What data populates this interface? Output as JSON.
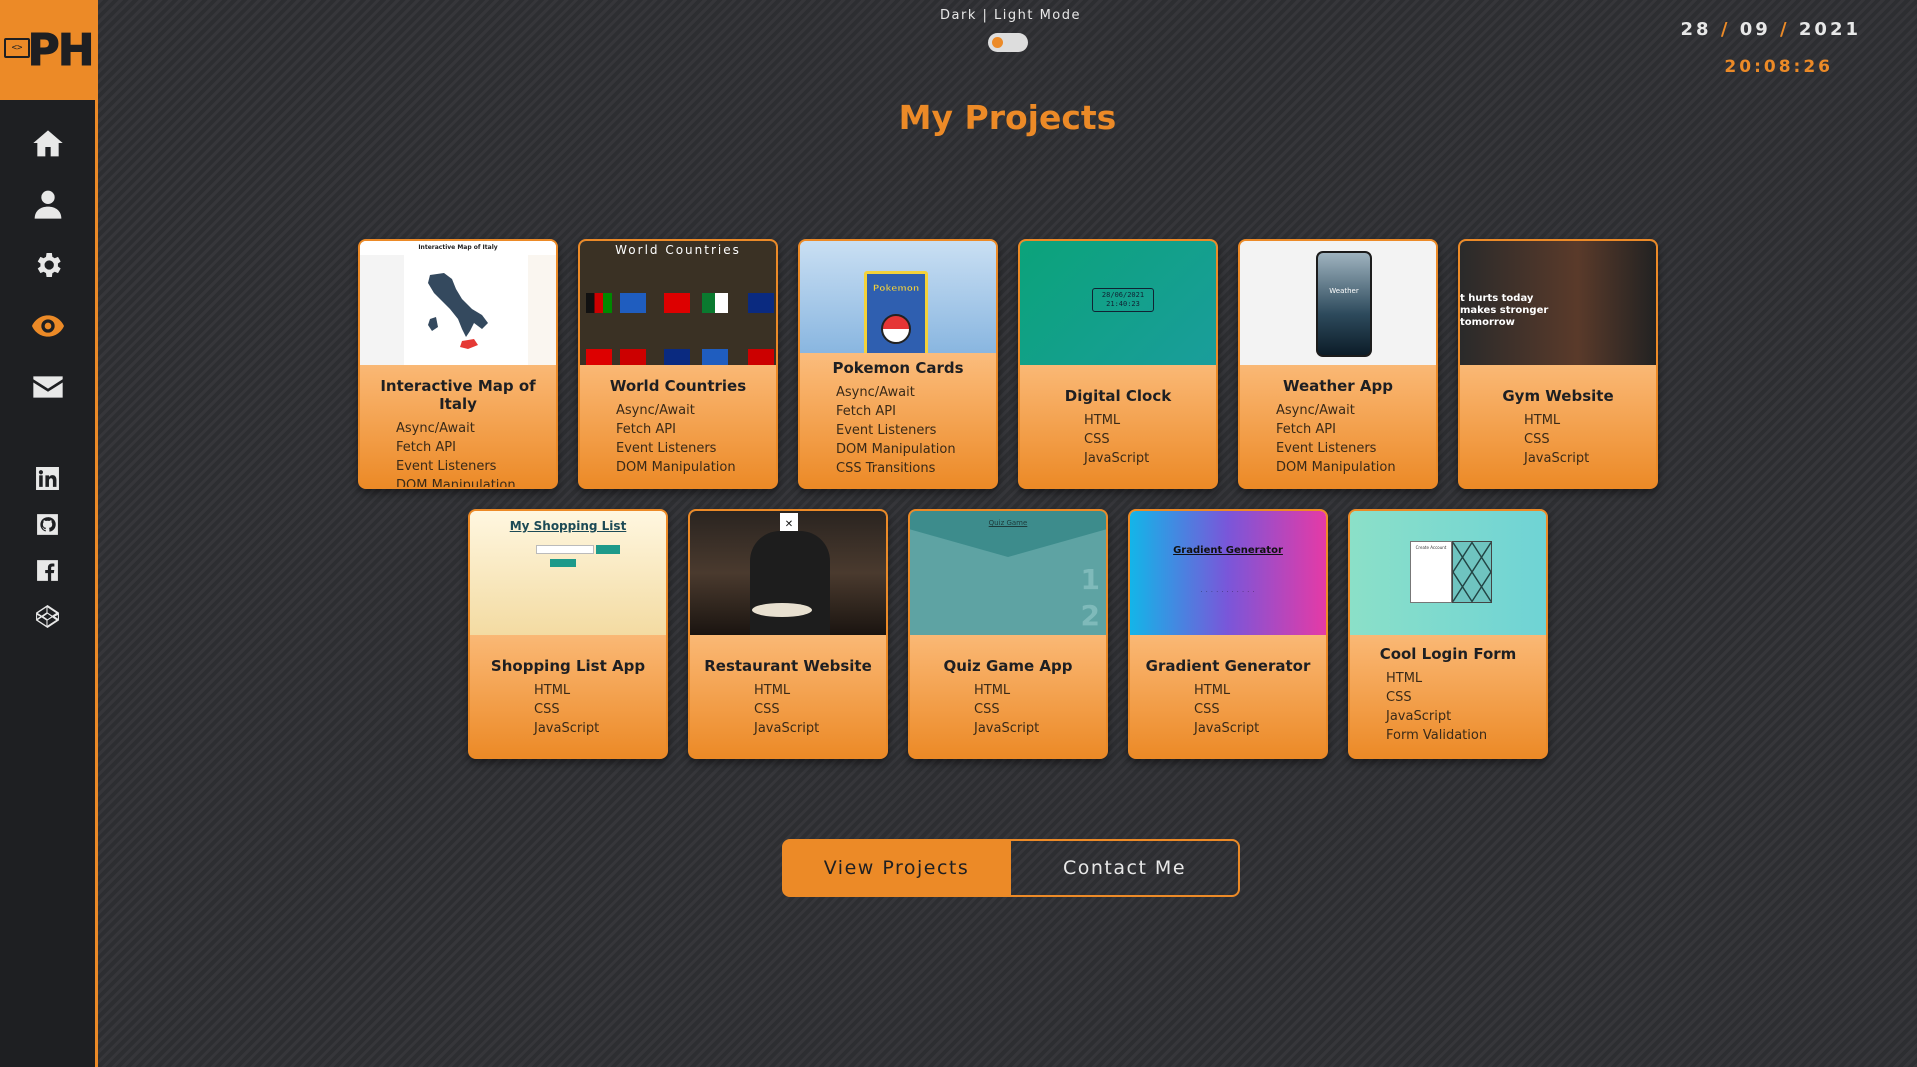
{
  "logo": {
    "text": "PH",
    "code_symbol": "<>"
  },
  "nav": {
    "items": [
      {
        "icon": "home-icon",
        "active": false
      },
      {
        "icon": "user-icon",
        "active": false
      },
      {
        "icon": "gear-icon",
        "active": false
      },
      {
        "icon": "eye-icon",
        "active": true
      },
      {
        "icon": "envelope-icon",
        "active": false
      }
    ],
    "social": [
      "linkedin-icon",
      "github-icon",
      "facebook-icon",
      "codepen-icon"
    ]
  },
  "mode": {
    "label": "Dark | Light Mode"
  },
  "clock": {
    "day": "28",
    "month": "09",
    "year": "2021",
    "sep": "/",
    "time": "20:08:26"
  },
  "page": {
    "title": "My Projects"
  },
  "projects": [
    {
      "title": "Interactive Map of Italy",
      "tags": [
        "Async/Await",
        "Fetch API",
        "Event Listeners",
        "DOM Manipulation"
      ],
      "thumb_text": "Interactive Map of Italy"
    },
    {
      "title": "World Countries",
      "tags": [
        "Async/Await",
        "Fetch API",
        "Event Listeners",
        "DOM Manipulation"
      ],
      "thumb_text": "World Countries"
    },
    {
      "title": "Pokemon Cards",
      "tags": [
        "Async/Await",
        "Fetch API",
        "Event Listeners",
        "DOM Manipulation",
        "CSS Transitions"
      ],
      "thumb_text": "Pokemon"
    },
    {
      "title": "Digital Clock",
      "tags": [
        "HTML",
        "CSS",
        "JavaScript"
      ],
      "thumb_text": "28/06/2021 21:40:23"
    },
    {
      "title": "Weather App",
      "tags": [
        "Async/Await",
        "Fetch API",
        "Event Listeners",
        "DOM Manipulation"
      ],
      "thumb_text": "Weather"
    },
    {
      "title": "Gym Website",
      "tags": [
        "HTML",
        "CSS",
        "JavaScript"
      ],
      "thumb_text": "t hurts today makes stronger tomorrow"
    },
    {
      "title": "Shopping List App",
      "tags": [
        "HTML",
        "CSS",
        "JavaScript"
      ],
      "thumb_text": "My Shopping List"
    },
    {
      "title": "Restaurant Website",
      "tags": [
        "HTML",
        "CSS",
        "JavaScript"
      ],
      "thumb_text": ""
    },
    {
      "title": "Quiz Game App",
      "tags": [
        "HTML",
        "CSS",
        "JavaScript"
      ],
      "thumb_text": "Quiz Game"
    },
    {
      "title": "Gradient Generator",
      "tags": [
        "HTML",
        "CSS",
        "JavaScript"
      ],
      "thumb_text": "Gradient Generator"
    },
    {
      "title": "Cool Login Form",
      "tags": [
        "HTML",
        "CSS",
        "JavaScript",
        "Form Validation"
      ],
      "thumb_text": "Create Account"
    }
  ],
  "buttons": {
    "view": "View Projects",
    "contact": "Contact Me"
  },
  "colors": {
    "accent": "#ec8a27",
    "sidebar": "#1e1f22",
    "background": "#2f3034"
  }
}
